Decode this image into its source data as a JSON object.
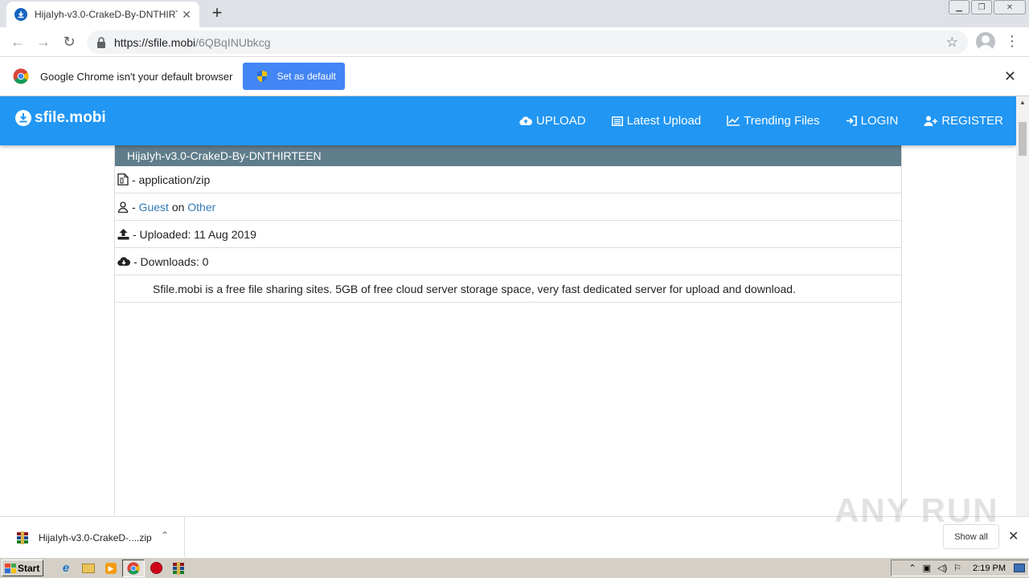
{
  "browser": {
    "tab_title": "HijaIyh-v3.0-CrakeD-By-DNTHIRTEEN",
    "url_host": "https://sfile.mobi",
    "url_path": "/6QBqINUbkcg"
  },
  "infobar": {
    "message": "Google Chrome isn't your default browser",
    "button_label": "Set as default"
  },
  "site": {
    "brand": "sfile.mobi",
    "nav": [
      {
        "label": "UPLOAD",
        "icon": "cloud-upload-icon"
      },
      {
        "label": "Latest Upload",
        "icon": "list-icon"
      },
      {
        "label": "Trending Files",
        "icon": "line-chart-icon"
      },
      {
        "label": "LOGIN",
        "icon": "sign-in-icon"
      },
      {
        "label": "REGISTER",
        "icon": "user-plus-icon"
      }
    ],
    "colors": {
      "navbar": "#2196f3",
      "file_header": "#607d8b",
      "link": "#337ab7"
    }
  },
  "file": {
    "name": "HijaIyh-v3.0-CrakeD-By-DNTHIRTEEN",
    "mime": "- application/zip",
    "user_sep": "-",
    "user": "Guest",
    "on": "on",
    "category": "Other",
    "uploaded": "- Uploaded: 11 Aug 2019",
    "downloads": "- Downloads: 0",
    "description": "Sfile.mobi is a free file sharing sites. 5GB of free cloud server storage space, very fast dedicated server for upload and download."
  },
  "downloads_bar": {
    "item_name": "HijaIyh-v3.0-CrakeD-....zip",
    "show_all": "Show all",
    "watermark": "ANY RUN"
  },
  "taskbar": {
    "start_label": "Start",
    "clock": "2:19 PM"
  }
}
